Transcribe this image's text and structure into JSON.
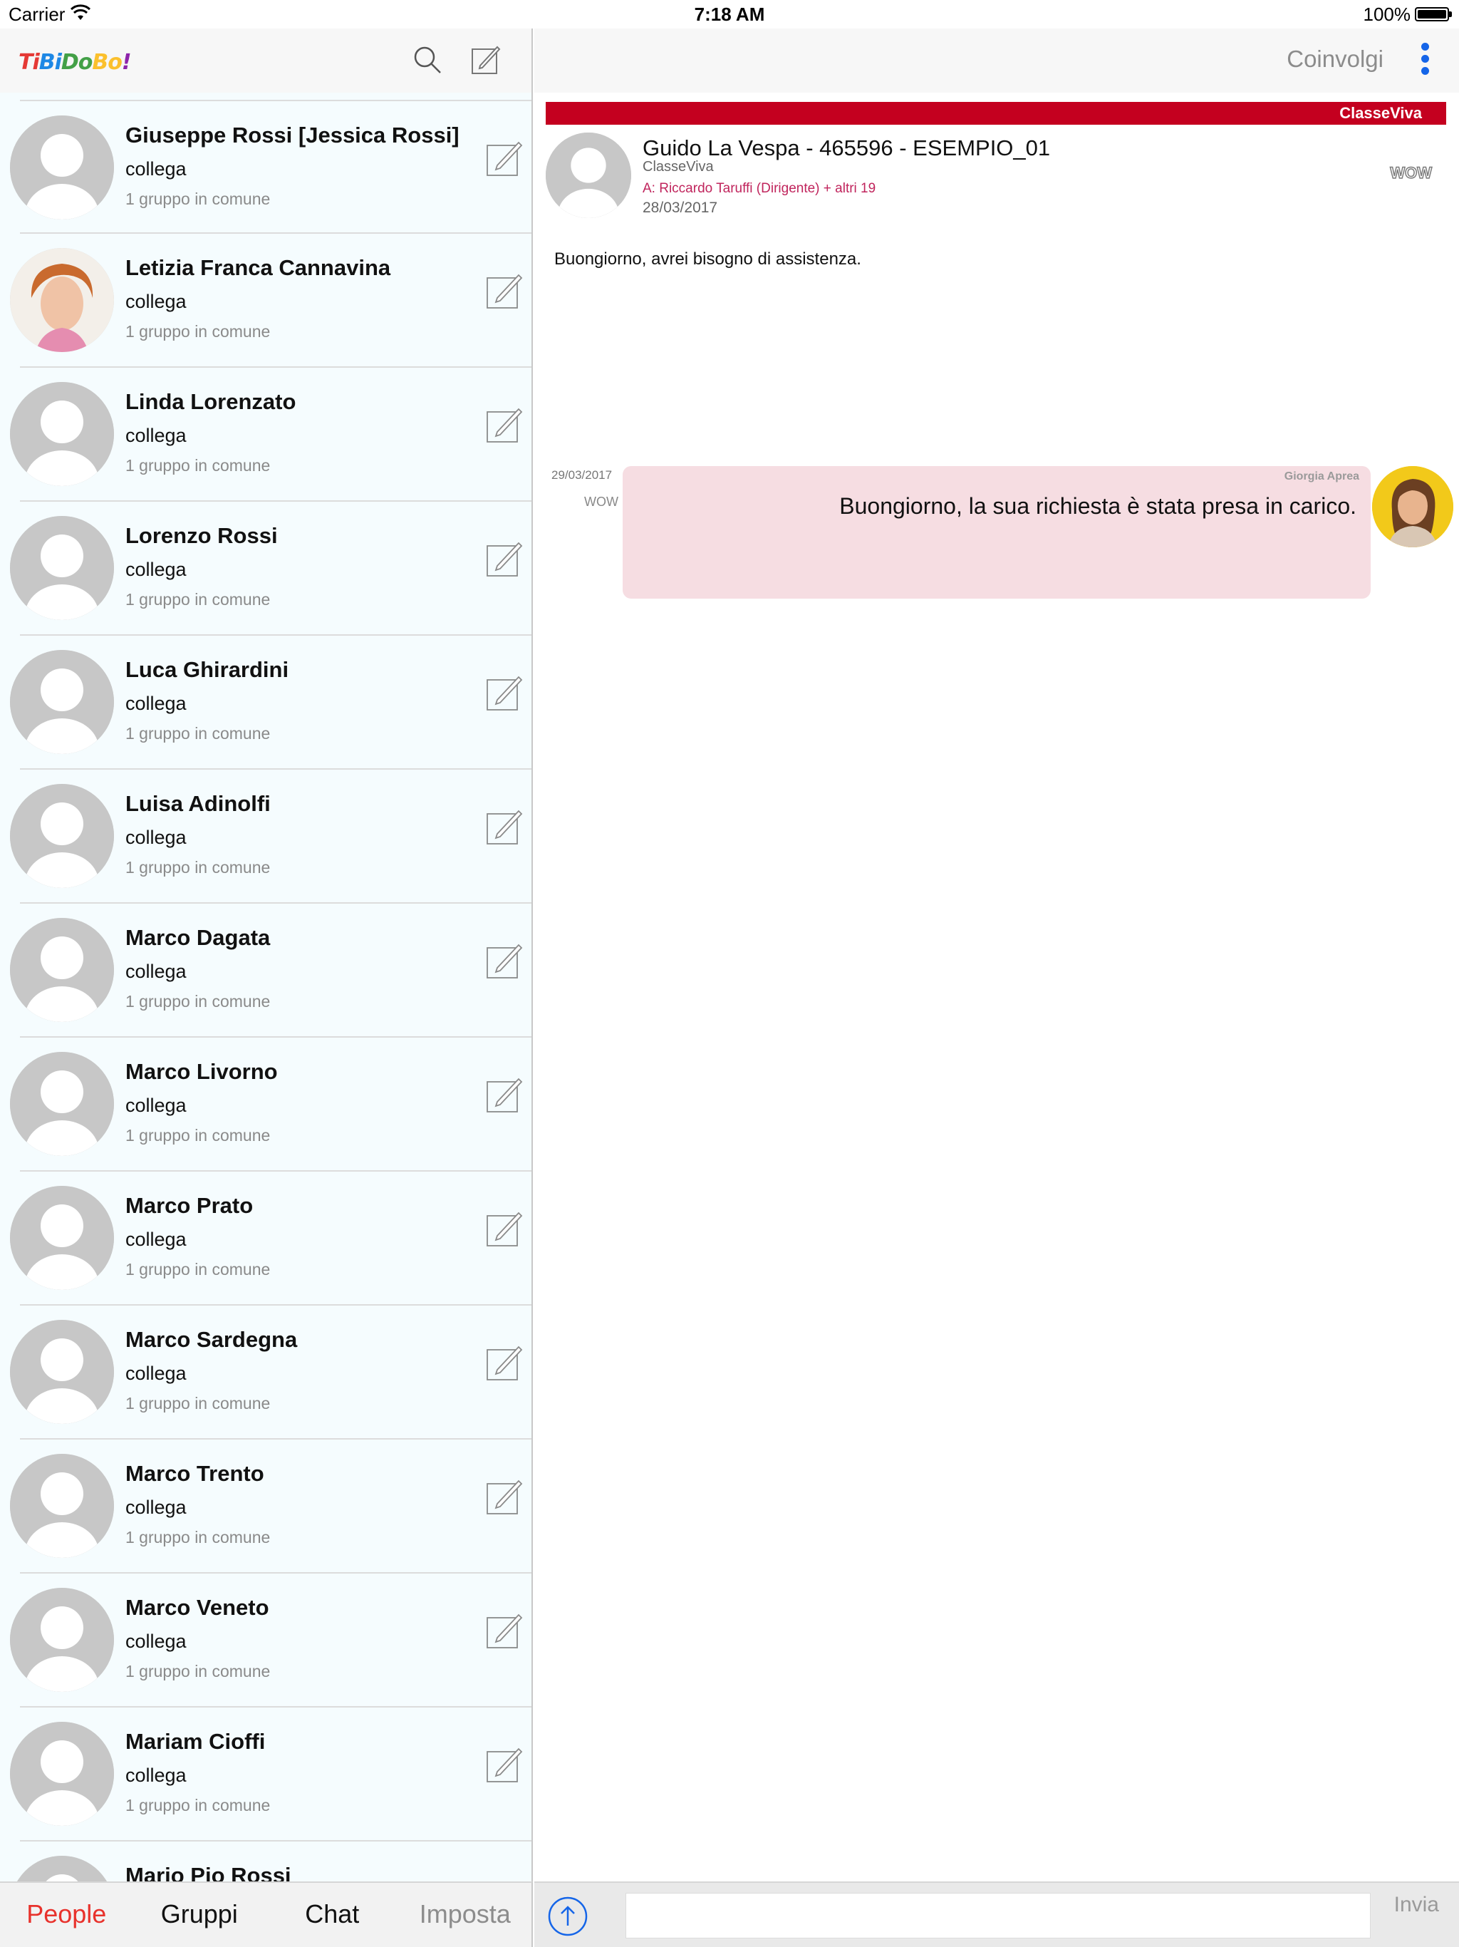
{
  "status_bar": {
    "carrier": "Carrier",
    "time": "7:18 AM",
    "battery": "100%"
  },
  "app": {
    "logo_letters": [
      "Ti",
      "Bi",
      "Do",
      "Bo",
      "!"
    ]
  },
  "contacts": [
    {
      "name": "Giuseppe Rossi [Jessica Rossi]",
      "role": "collega",
      "groups": "1 gruppo in comune",
      "photo": false
    },
    {
      "name": "Letizia Franca Cannavina",
      "role": "collega",
      "groups": "1 gruppo in comune",
      "photo": true
    },
    {
      "name": "Linda Lorenzato",
      "role": "collega",
      "groups": "1 gruppo in comune",
      "photo": false
    },
    {
      "name": "Lorenzo Rossi",
      "role": "collega",
      "groups": "1 gruppo in comune",
      "photo": false
    },
    {
      "name": "Luca Ghirardini",
      "role": "collega",
      "groups": "1 gruppo in comune",
      "photo": false
    },
    {
      "name": "Luisa Adinolfi",
      "role": "collega",
      "groups": "1 gruppo in comune",
      "photo": false
    },
    {
      "name": "Marco Dagata",
      "role": "collega",
      "groups": "1 gruppo in comune",
      "photo": false
    },
    {
      "name": "Marco Livorno",
      "role": "collega",
      "groups": "1 gruppo in comune",
      "photo": false
    },
    {
      "name": "Marco Prato",
      "role": "collega",
      "groups": "1 gruppo in comune",
      "photo": false
    },
    {
      "name": "Marco Sardegna",
      "role": "collega",
      "groups": "1 gruppo in comune",
      "photo": false
    },
    {
      "name": "Marco Trento",
      "role": "collega",
      "groups": "1 gruppo in comune",
      "photo": false
    },
    {
      "name": "Marco Veneto",
      "role": "collega",
      "groups": "1 gruppo in comune",
      "photo": false
    },
    {
      "name": "Mariam Cioffi",
      "role": "collega",
      "groups": "1 gruppo in comune",
      "photo": false
    },
    {
      "name": "Mario Pio Rossi",
      "role": "",
      "groups": "",
      "photo": false
    }
  ],
  "tabs": [
    {
      "label": "People",
      "state": "active"
    },
    {
      "label": "Gruppi",
      "state": "normal"
    },
    {
      "label": "Chat",
      "state": "normal"
    },
    {
      "label": "Imposta",
      "state": "dim"
    }
  ],
  "detail": {
    "nav_action": "Coinvolgi",
    "source_label": "ClasseViva",
    "message": {
      "title": "Guido La Vespa - 465596 - ESEMPIO_01",
      "sender": "ClasseViva",
      "recipients": "A: Riccardo Taruffi (Dirigente) + altri 19",
      "date": "28/03/2017",
      "badge": "WOW",
      "body": "Buongiorno, avrei bisogno di assistenza."
    },
    "reply": {
      "date": "29/03/2017",
      "tag": "WOW",
      "author": "Giorgia Aprea",
      "text": "Buongiorno, la sua richiesta è stata presa in carico."
    },
    "composer": {
      "placeholder": "",
      "send_label": "Invia"
    }
  },
  "colors": {
    "accent": "#e8322c",
    "banner": "#c4001f",
    "bubble": "#f6dde2",
    "link_blue": "#1565e8"
  },
  "icons": [
    "wifi-icon",
    "battery-icon",
    "search-icon",
    "compose-icon",
    "more-vertical-icon",
    "upload-arrow-icon",
    "default-avatar-icon"
  ]
}
